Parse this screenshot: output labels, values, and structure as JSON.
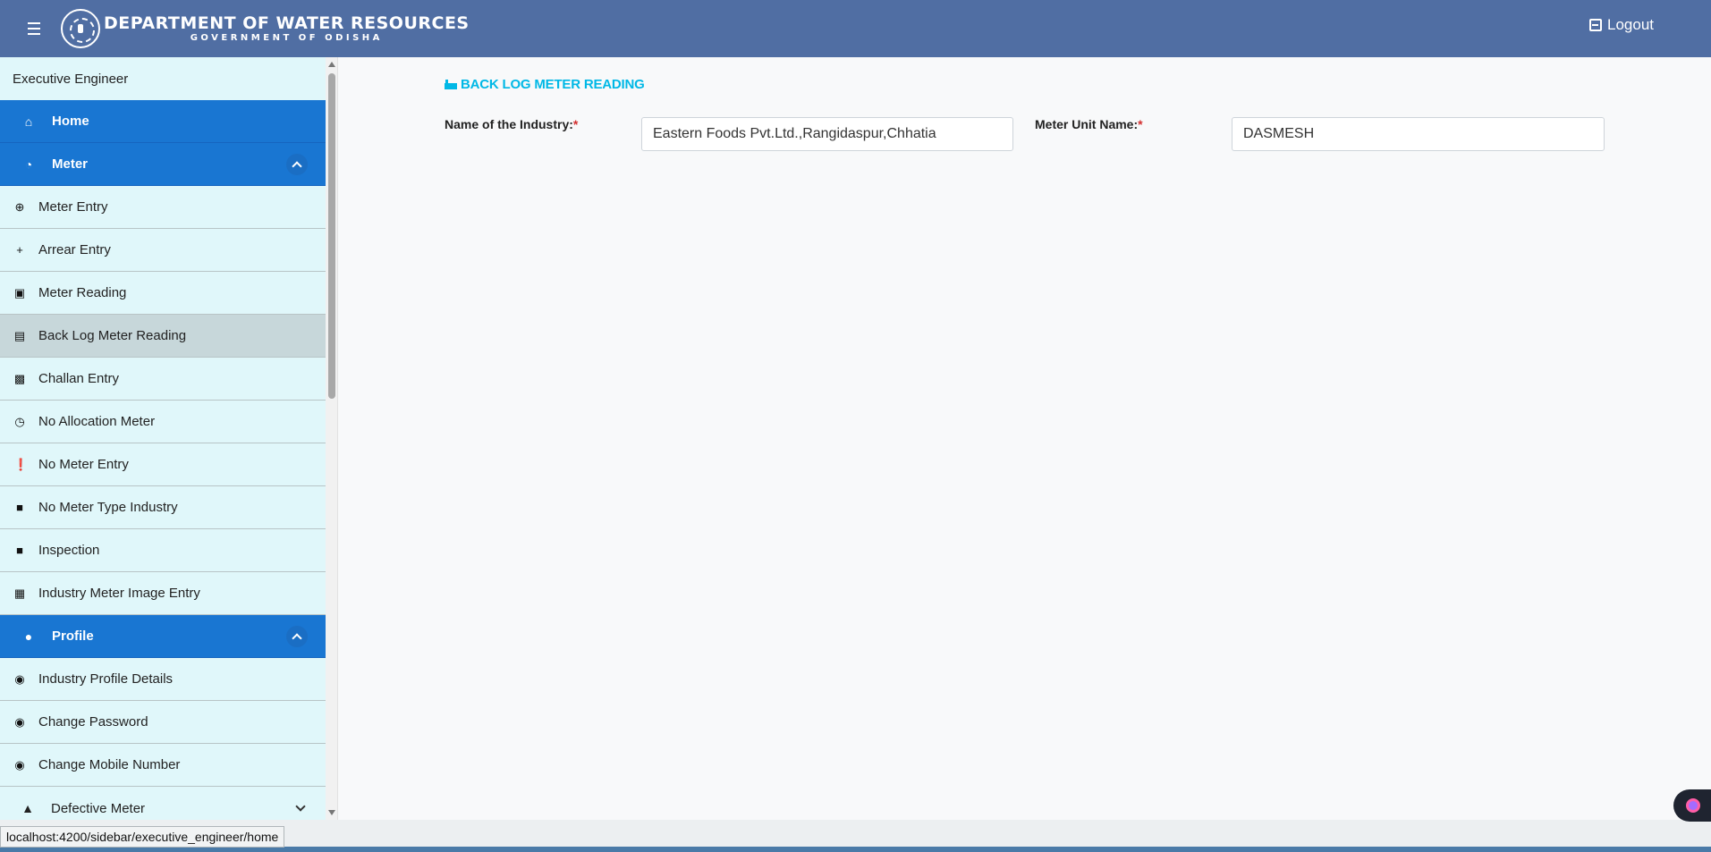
{
  "header": {
    "title": "DEPARTMENT OF WATER RESOURCES",
    "subtitle": "GOVERNMENT OF ODISHA",
    "logout_label": "Logout"
  },
  "sidebar": {
    "role": "Executive Engineer",
    "home": {
      "label": "Home",
      "icon": "home-icon"
    },
    "meter": {
      "label": "Meter",
      "icon": "meter-icon"
    },
    "meter_items": [
      {
        "label": "Meter Entry",
        "icon": "plus-circle-icon"
      },
      {
        "label": "Arrear Entry",
        "icon": "plus-icon"
      },
      {
        "label": "Meter Reading",
        "icon": "search-box-icon"
      },
      {
        "label": "Back Log Meter Reading",
        "icon": "list-icon"
      },
      {
        "label": "Challan Entry",
        "icon": "file-download-icon"
      },
      {
        "label": "No Allocation Meter",
        "icon": "timer-icon"
      },
      {
        "label": "No Meter Entry",
        "icon": "alert-circle-icon"
      },
      {
        "label": "No Meter Type Industry",
        "icon": "briefcase-icon"
      },
      {
        "label": "Inspection",
        "icon": "briefcase-icon"
      },
      {
        "label": "Industry Meter Image Entry",
        "icon": "add-photo-icon"
      }
    ],
    "profile": {
      "label": "Profile",
      "icon": "person-icon"
    },
    "profile_items": [
      {
        "label": "Industry Profile Details",
        "icon": "account-circle-icon"
      },
      {
        "label": "Change Password",
        "icon": "account-circle-icon"
      },
      {
        "label": "Change Mobile Number",
        "icon": "account-circle-icon"
      }
    ],
    "defective": {
      "label": "Defective Meter",
      "icon": "warning-icon"
    }
  },
  "main": {
    "page_title": "BACK LOG METER READING",
    "industry_label": "Name of the Industry:",
    "industry_value": "Eastern Foods Pvt.Ltd.,Rangidaspur,Chhatia",
    "meter_unit_label": "Meter Unit Name:",
    "meter_unit_value": "DASMESH",
    "required_mark": "*"
  },
  "status_url": "localhost:4200/sidebar/executive_engineer/home",
  "colors": {
    "header_bg": "#506ea3",
    "sidebar_bg": "#e0f7fa",
    "nav_active_bg": "#1976d2",
    "title_accent": "#00b8e6",
    "required": "#d32f2f"
  }
}
